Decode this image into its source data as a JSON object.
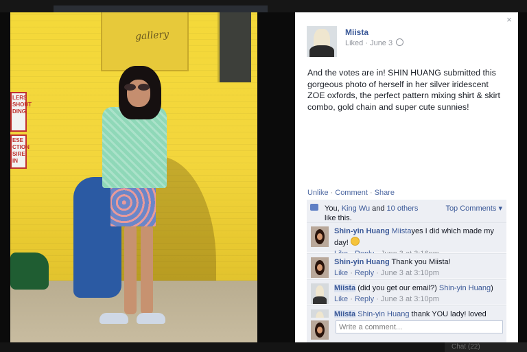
{
  "background": {
    "chat_label": "Chat (22)"
  },
  "photo": {
    "sign_text": "gallery",
    "red_sign_1": "LERS SHOUT DING",
    "red_sign_2": "ESE CTION SIRE IN"
  },
  "panel": {
    "close_glyph": "×",
    "author": "Miista",
    "meta": "Liked · June 3",
    "caption": "And the votes are in! SHIN HUANG submitted this gorgeous photo of herself in her silver iridescent ZOE oxfords, the perfect pattern mixing shirt & skirt combo, gold chain and super cute sunnies!",
    "actions": {
      "unlike": "Unlike",
      "comment": "Comment",
      "share": "Share"
    },
    "likes": {
      "prefix": "You, ",
      "friend": "King Wu",
      "and": " and ",
      "others": "10 others",
      "suffix": " like this.",
      "top_comments": "Top Comments ▾"
    },
    "comments": [
      {
        "author": "Shin-yin Huang",
        "tag": "Miista",
        "text": "yes I did which made my day! ",
        "like": "Like",
        "reply": "Reply",
        "time": "June 3 at 3:16pm"
      },
      {
        "author": "Shin-yin Huang",
        "text": " Thank you Miista!",
        "like": "Like",
        "reply": "Reply",
        "time": "June 3 at 3:10pm"
      },
      {
        "author": "Miista",
        "text": " (did you get our email?) ",
        "tag": "Shin-yin Huang",
        "text_end": ")",
        "like": "Like",
        "reply": "Reply",
        "time": "June 3 at 3:10pm"
      },
      {
        "author": "Miista",
        "tag": "Shin-yin Huang",
        "text": " thank YOU lady! loved"
      }
    ],
    "write_placeholder": "Write a comment..."
  }
}
